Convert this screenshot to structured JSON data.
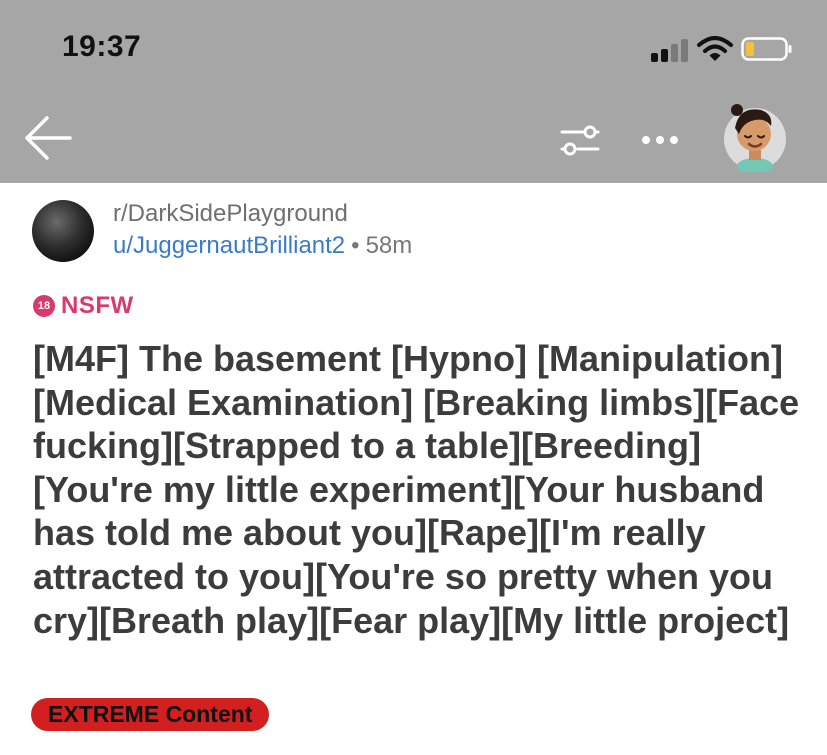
{
  "status_bar": {
    "time": "19:37",
    "icons": [
      "cellular-signal-icon",
      "wifi-icon",
      "battery-icon"
    ]
  },
  "nav": {
    "back_icon": "arrow-left-icon",
    "filter_icon": "sliders-icon",
    "more_icon": "ellipsis-icon",
    "avatar_icon": "user-avatar-icon"
  },
  "post": {
    "subreddit": "r/DarkSidePlayground",
    "username": "u/JuggernautBrilliant2",
    "separator": "•",
    "age": "58m",
    "nsfw_badge": "18",
    "nsfw_label": "NSFW",
    "title": "[M4F] The basement [Hypno] [Manipulation][Medical Examination] [Breaking limbs][Face fucking][Strapped to a table][Breeding][You're my little experiment][Your husband has told me about you][Rape][I'm really attracted to you][You're so pretty when you cry][Breath play][Fear play][My little project]",
    "flair": "EXTREME Content"
  },
  "colors": {
    "header_bg": "#a6a6a6",
    "nsfw": "#d93a6b",
    "username_link": "#3a7bc8",
    "flair_bg": "#d21f1f",
    "title_text": "#3c3c3c"
  }
}
